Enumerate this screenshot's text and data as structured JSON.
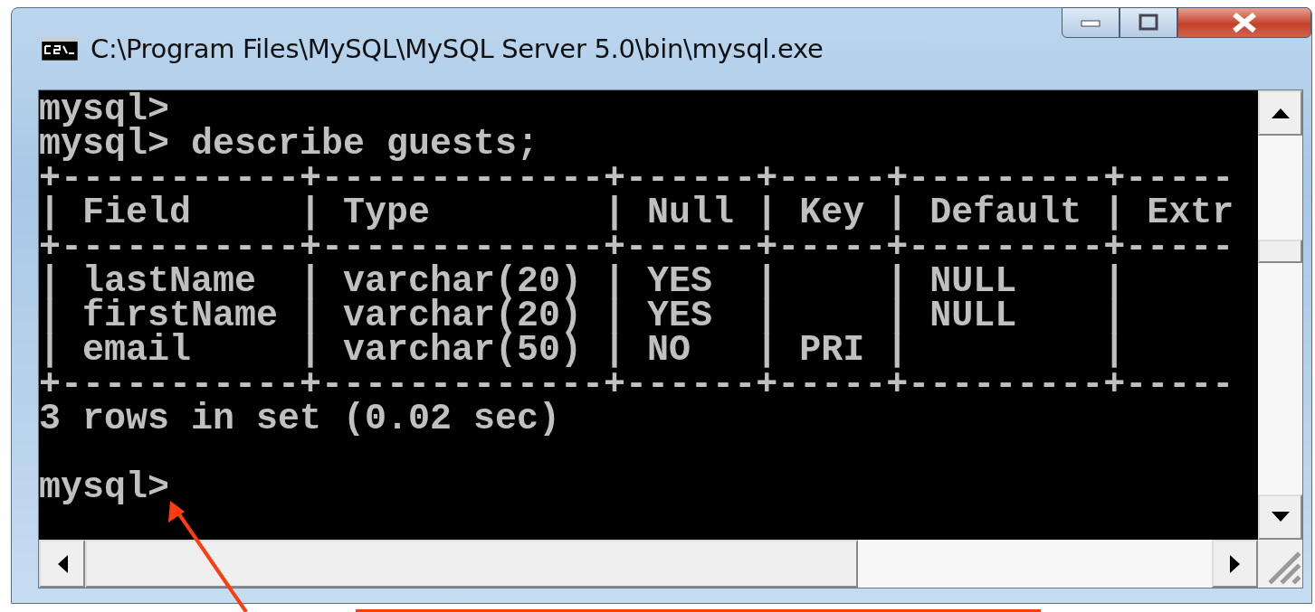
{
  "window": {
    "title": "C:\\Program Files\\MySQL\\MySQL Server 5.0\\bin\\mysql.exe"
  },
  "console": {
    "lines": [
      {
        "kind": "text",
        "text": "mysql>"
      },
      {
        "kind": "text",
        "text": "mysql> describe guests;"
      },
      {
        "kind": "text",
        "text": "+-----------+-------------+------+-----+---------+-----"
      },
      {
        "kind": "text",
        "text": "| Field     | Type        | Null | Key | Default | Extr"
      },
      {
        "kind": "text",
        "text": "+-----------+-------------+------+-----+---------+-----"
      },
      {
        "kind": "text",
        "text": "| lastName  | varchar(20) | YES  |     | NULL    |"
      },
      {
        "kind": "text",
        "text": "| firstName | varchar(20) | YES  |     | NULL    |"
      },
      {
        "kind": "text",
        "text": "| email     | varchar(50) | NO   | PRI |         |"
      },
      {
        "kind": "text",
        "text": "+-----------+-------------+------+-----+---------+-----"
      },
      {
        "kind": "text",
        "text": "3 rows in set (0.02 sec)"
      },
      {
        "kind": "blank"
      },
      {
        "kind": "text",
        "text": "mysql>"
      }
    ]
  }
}
